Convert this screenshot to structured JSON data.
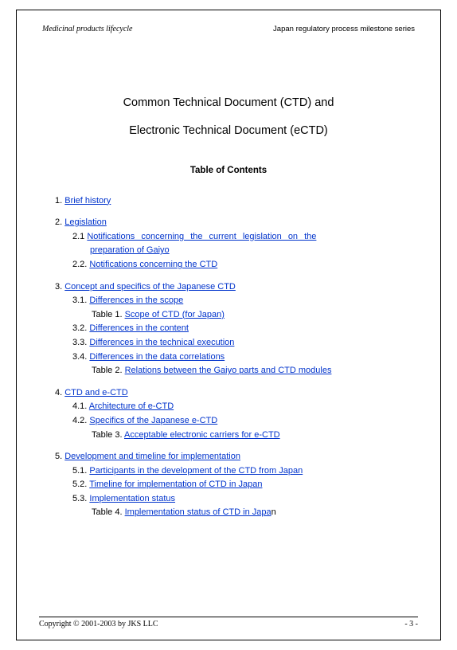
{
  "header": {
    "left": "Medicinal products lifecycle",
    "right": "Japan regulatory process milestone series"
  },
  "title": {
    "line1": "Common Technical Document (CTD) and",
    "line2": "Electronic Technical Document (eCTD)"
  },
  "toc_label": "Table of Contents",
  "toc": {
    "s1": {
      "num": "1. ",
      "text": "Brief history"
    },
    "s2": {
      "num": "2. ",
      "text": "Legislation",
      "s21": {
        "num": "2.1 ",
        "text": "Notifications concerning the current legislation on the",
        "cont": "preparation of Gaiyo"
      },
      "s22": {
        "num": "2.2. ",
        "text": "Notifications concerning the CTD"
      }
    },
    "s3": {
      "num": "3. ",
      "text": "Concept and specifics of the Japanese CTD",
      "s31": {
        "num": "3.1. ",
        "text": "Differences in the scope",
        "t1": {
          "label": "Table 1. ",
          "text": "Scope of CTD (for Japan)"
        }
      },
      "s32": {
        "num": "3.2. ",
        "text": "Differences in the content"
      },
      "s33": {
        "num": "3.3. ",
        "text": "Differences in the technical execution"
      },
      "s34": {
        "num": "3.4. ",
        "text": "Differences in the data correlations",
        "t2": {
          "label": "Table 2. ",
          "text": "Relations between the Gaiyo parts and CTD modules"
        }
      }
    },
    "s4": {
      "num": "4. ",
      "text": "CTD and e-CTD",
      "s41": {
        "num": "4.1. ",
        "text": "Architecture of e-CTD"
      },
      "s42": {
        "num": "4.2. ",
        "text": "Specifics of the Japanese e-CTD",
        "t3": {
          "label": "Table 3. ",
          "text": "Acceptable electronic carriers for e-CTD"
        }
      }
    },
    "s5": {
      "num": "5. ",
      "text": "Development and timeline for implementation",
      "s51": {
        "num": "5.1. ",
        "text": "Participants in the development of the CTD from Japan"
      },
      "s52": {
        "num": "5.2. ",
        "text": "Timeline for implementation of CTD in Japan"
      },
      "s53": {
        "num": "5.3. ",
        "text": "Implementation status",
        "t4": {
          "label": "Table 4. ",
          "text": "Implementation status of CTD in Japa",
          "tail": "n"
        }
      }
    }
  },
  "footer": {
    "left": "Copyright © 2001-2003 by JKS LLC",
    "right": "- 3 -"
  }
}
